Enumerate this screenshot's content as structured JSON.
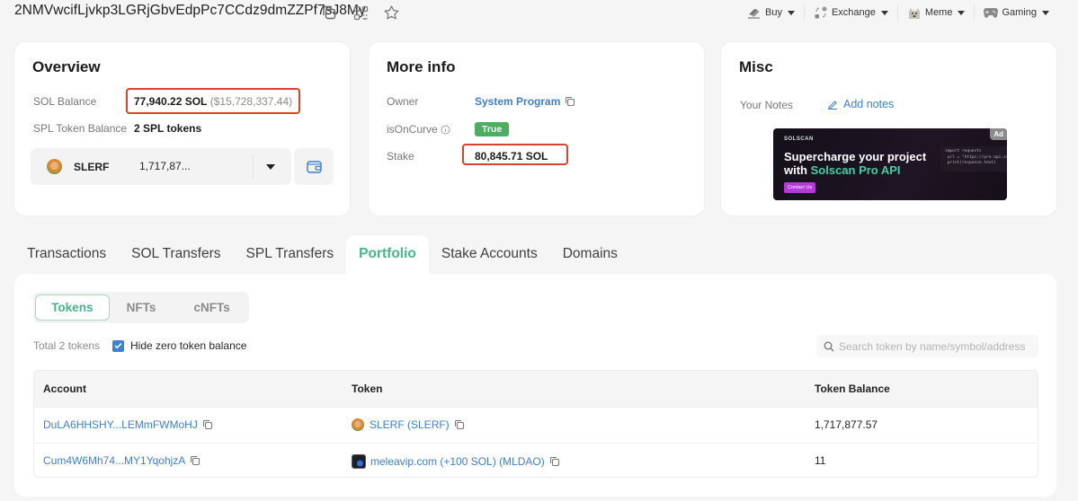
{
  "header": {
    "address": "2NMVwcifLjvkp3LGRjGbvEdpPc7CCdz9dmZZPf7sJ8My",
    "icons": [
      "copy-icon",
      "qr-code-icon",
      "star-icon"
    ],
    "nav": [
      {
        "label": "Buy",
        "icon": "buy-icon"
      },
      {
        "label": "Exchange",
        "icon": "exchange-icon"
      },
      {
        "label": "Meme",
        "icon": "doge-icon"
      },
      {
        "label": "Gaming",
        "icon": "gamepad-icon"
      }
    ]
  },
  "overview": {
    "title": "Overview",
    "sol_balance_label": "SOL Balance",
    "sol_balance": "77,940.22 SOL",
    "sol_balance_usd": "($15,728,337.44)",
    "spl_label": "SPL Token Balance",
    "spl_value": "2 SPL tokens",
    "selected_token": {
      "symbol": "SLERF",
      "amount": "1,717,87..."
    }
  },
  "more_info": {
    "title": "More info",
    "owner_label": "Owner",
    "owner_value": "System Program",
    "curve_label": "isOnCurve",
    "curve_value": "True",
    "stake_label": "Stake",
    "stake_value": "80,845.71 SOL"
  },
  "misc": {
    "title": "Misc",
    "notes_label": "Your Notes",
    "add_notes": "Add notes",
    "ad": {
      "brand": "SOLSCAN",
      "headline_1": "Supercharge your project",
      "headline_2_prefix": "with ",
      "headline_2_accent": "Solscan Pro API",
      "cta": "Contact Us",
      "tag": "Ad",
      "code": "import requests\n url = \"https://pro-api.so\n print(response.text)"
    }
  },
  "tabs": [
    {
      "label": "Transactions",
      "active": false
    },
    {
      "label": "SOL Transfers",
      "active": false
    },
    {
      "label": "SPL Transfers",
      "active": false
    },
    {
      "label": "Portfolio",
      "active": true
    },
    {
      "label": "Stake Accounts",
      "active": false
    },
    {
      "label": "Domains",
      "active": false
    }
  ],
  "portfolio": {
    "subtabs": [
      {
        "label": "Tokens",
        "active": true
      },
      {
        "label": "NFTs",
        "active": false
      },
      {
        "label": "cNFTs",
        "active": false
      }
    ],
    "total": "Total 2 tokens",
    "hide_zero_label": "Hide zero token balance",
    "hide_zero_checked": true,
    "search_placeholder": "Search token by name/symbol/address",
    "columns": [
      "Account",
      "Token",
      "Token Balance"
    ],
    "rows": [
      {
        "account": "DuLA6HHSHY...LEMmFWMoHJ",
        "token": "SLERF (SLERF)",
        "balance": "1,717,877.57"
      },
      {
        "account": "Cum4W6Mh74...MY1YqohjzA",
        "token": "meleavip.com (+100 SOL) (MLDAO)",
        "balance": "11"
      }
    ]
  },
  "colors": {
    "accent_green": "#45b68a",
    "link_blue": "#3d7fd1",
    "highlight_red": "#d9432f",
    "badge_green": "#4caf60"
  }
}
